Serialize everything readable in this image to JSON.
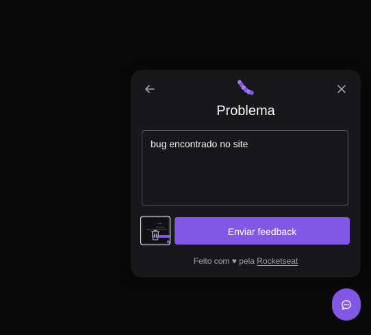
{
  "form": {
    "title": "Problema",
    "back_icon": "arrow-left-icon",
    "close_icon": "close-icon",
    "type_icon": "bug-icon",
    "feedback_text": "bug encontrado no site",
    "screenshot_icon": "trash-icon",
    "submit_label": "Enviar feedback"
  },
  "footer": {
    "prefix": "Feito com ♥ pela ",
    "link_text": "Rocketseat"
  },
  "launcher": {
    "icon": "chat-bubble-icon"
  },
  "colors": {
    "background": "#09090a",
    "panel": "#18181b",
    "brand": "#8257e5",
    "text": "#f4f4f5",
    "muted": "#a1a1aa",
    "border": "#52525b"
  }
}
